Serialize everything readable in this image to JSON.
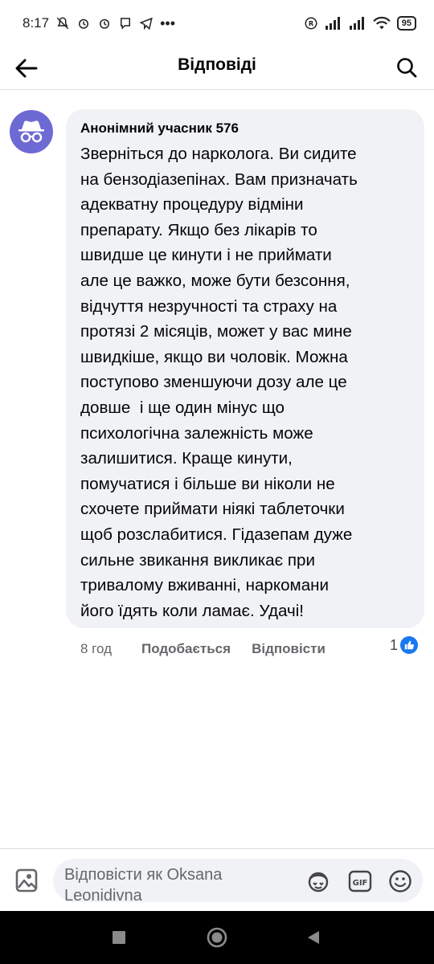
{
  "status_bar": {
    "time": "8:17",
    "battery": "95"
  },
  "header": {
    "title": "Відповіді"
  },
  "comment": {
    "author": "Анонімний учасник 576",
    "text": "Зверніться до нарколога. Ви сидите\nна бензодіазепінах. Вам призначать\nадекватну процедуру відміни\nпрепарату. Якщо без лікарів то\nшвидше це кинути і не приймати\nале це важко, може бути безсоння,\nвідчуття незручності та страху на\nпротязі 2 місяців, может у вас мине\nшвидкіше, якщо ви чоловік. Можна\nпоступово зменшуючи дозу але це\nдовше  і ще один мінус що\nпсихологічна залежність може\nзалишитися. Краще кинути,\nпомучатися і більше ви ніколи не\nсхочете приймати ніякі таблеточки\nщоб розслабитися. Гідазепам дуже\nсильне звикання викликає при\nтривалому вживанні, наркомани\nйого їдять коли ламає. Удачі!",
    "time": "8 год",
    "like_label": "Подобається",
    "reply_label": "Відповісти",
    "reaction_count": "1"
  },
  "composer": {
    "placeholder": "Відповісти як Oksana Leonidivna"
  },
  "icons": {
    "accent": "#1877f2",
    "avatar_bg": "#6e6ad4"
  }
}
